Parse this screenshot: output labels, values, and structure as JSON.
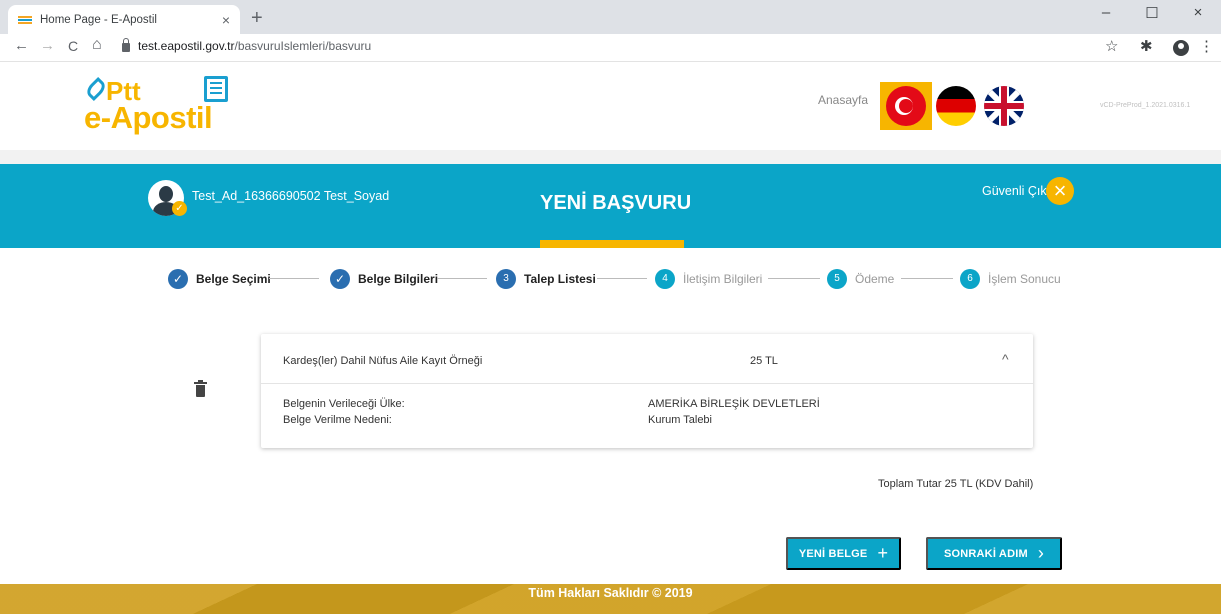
{
  "browser": {
    "tab_title": "Home Page - E-Apostil",
    "tab_close": "×",
    "new_tab": "+",
    "url_host": "test.eapostil.gov.tr",
    "url_path": "/basvuruIslemleri/basvuru",
    "minimize": "–",
    "maximize": "☐",
    "close": "×",
    "back": "←",
    "forward": "→",
    "reload": "C",
    "home": "⌂",
    "star": "☆",
    "extensions": "✱",
    "menu": "⋮"
  },
  "header": {
    "logo_ptt": "Ptt",
    "logo_main": "e-Apostil",
    "home_link": "Anasayfa",
    "version": "vCD-PreProd_1.2021.0316.1"
  },
  "banner": {
    "user_name": "Test_Ad_16366690502 Test_Soyad",
    "page_title": "YENİ BAŞVURU",
    "logout": "Güvenli Çıkış",
    "logout_icon": "×",
    "avatar_check": "✓"
  },
  "steps": [
    {
      "num": "✓",
      "label": "Belge Seçimi",
      "state": "done"
    },
    {
      "num": "✓",
      "label": "Belge Bilgileri",
      "state": "done"
    },
    {
      "num": "3",
      "label": "Talep Listesi",
      "state": "active"
    },
    {
      "num": "4",
      "label": "İletişim Bilgileri",
      "state": "todo"
    },
    {
      "num": "5",
      "label": "Ödeme",
      "state": "todo"
    },
    {
      "num": "6",
      "label": "İşlem Sonucu",
      "state": "todo"
    }
  ],
  "request": {
    "document_name": "Kardeş(ler) Dahil Nüfus Aile Kayıt Örneği",
    "price": "25 TL",
    "chevron": "^",
    "country_label": "Belgenin Verileceği Ülke:",
    "country_value": "AMERİKA BİRLEŞİK DEVLETLERİ",
    "reason_label": "Belge Verilme Nedeni:",
    "reason_value": "Kurum Talebi"
  },
  "total": "Toplam Tutar 25 TL (KDV Dahil)",
  "buttons": {
    "new_document": "YENİ BELGE",
    "new_document_icon": "+",
    "next_step": "SONRAKİ ADIM",
    "next_step_icon": "›"
  },
  "footer": "Tüm Hakları Saklıdır © 2019",
  "colors": {
    "primary_blue": "#0ba5c8",
    "step_blue": "#2a6eb0",
    "accent_yellow": "#f7b500"
  }
}
